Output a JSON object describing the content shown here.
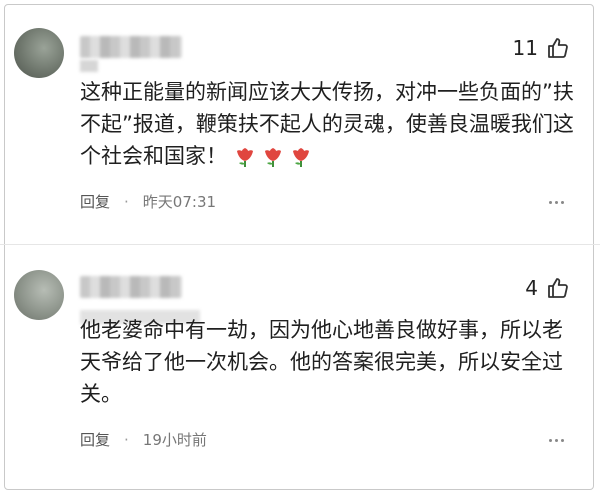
{
  "comments": [
    {
      "likes": "11",
      "text": "这种正能量的新闻应该大大传扬，对冲一些负面的”扶不起”报道，鞭策扶不起人的灵魂，使善良温暖我们这个社会和国家！",
      "reply_label": "回复",
      "separator": "·",
      "time": "昨天07:31",
      "emoji": "tulip-icon"
    },
    {
      "likes": "4",
      "text": "他老婆命中有一劫，因为他心地善良做好事，所以老天爷给了他一次机会。他的答案很完美，所以安全过关。",
      "reply_label": "回复",
      "separator": "·",
      "time": "19小时前"
    }
  ],
  "colors": {
    "text": "#1f1f1f",
    "meta": "#777777",
    "flower_red": "#e0463f"
  }
}
